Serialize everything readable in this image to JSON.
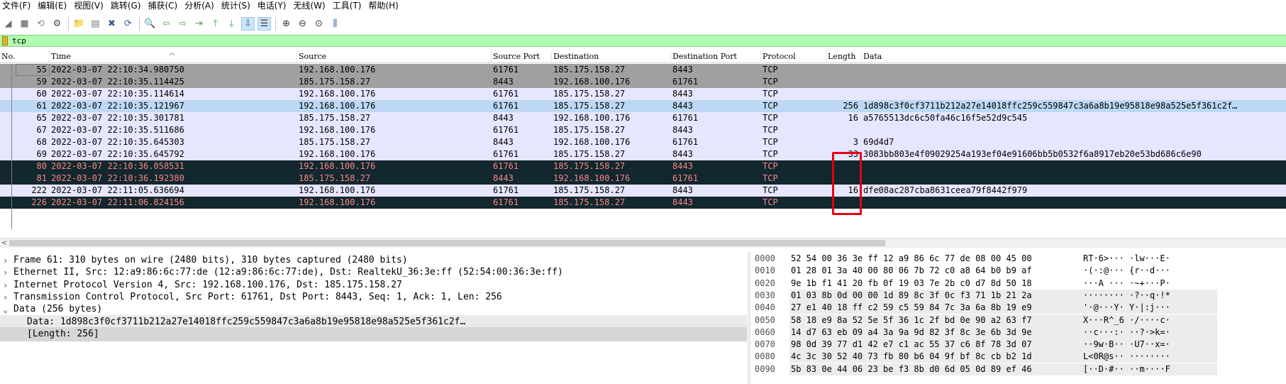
{
  "menu": [
    "文件(F)",
    "编辑(E)",
    "视图(V)",
    "跳转(G)",
    "捕获(C)",
    "分析(A)",
    "统计(S)",
    "电话(Y)",
    "无线(W)",
    "工具(T)",
    "帮助(H)"
  ],
  "toolbar": {
    "icons": [
      {
        "name": "shark-fin-start-icon",
        "glyph": "◢"
      },
      {
        "name": "stop-capture-icon",
        "glyph": "■"
      },
      {
        "name": "restart-capture-icon",
        "glyph": "⟲"
      },
      {
        "name": "capture-options-icon",
        "glyph": "⚙"
      },
      {
        "name": "open-file-icon",
        "glyph": "📁"
      },
      {
        "name": "save-file-icon",
        "glyph": "▤"
      },
      {
        "name": "close-file-icon",
        "glyph": "✖"
      },
      {
        "name": "reload-file-icon",
        "glyph": "⟳"
      },
      {
        "name": "find-packet-icon",
        "glyph": "🔍"
      },
      {
        "name": "go-back-icon",
        "glyph": "⇦"
      },
      {
        "name": "go-forward-icon",
        "glyph": "⇨"
      },
      {
        "name": "go-to-packet-icon",
        "glyph": "⇥"
      },
      {
        "name": "go-first-packet-icon",
        "glyph": "⤒"
      },
      {
        "name": "go-last-packet-icon",
        "glyph": "⤓"
      },
      {
        "name": "autoscroll-icon",
        "glyph": "⇩"
      },
      {
        "name": "colorize-icon",
        "glyph": "☰"
      },
      {
        "name": "zoom-in-icon",
        "glyph": "⊕"
      },
      {
        "name": "zoom-out-icon",
        "glyph": "⊖"
      },
      {
        "name": "zoom-normal-icon",
        "glyph": "⊙"
      },
      {
        "name": "resize-columns-icon",
        "glyph": "⫼"
      }
    ]
  },
  "filter": {
    "value": "tcp"
  },
  "columns": [
    "No.",
    "Time",
    "Source",
    "Source Port",
    "Destination",
    "Destination Port",
    "Protocol",
    "Length",
    "Data"
  ],
  "packets": [
    {
      "no": "55",
      "time": "2022-03-07 22:10:34.980750",
      "src": "192.168.100.176",
      "sport": "61761",
      "dst": "185.175.158.27",
      "dport": "8443",
      "proto": "TCP",
      "len": "",
      "data": "",
      "style": "gray"
    },
    {
      "no": "59",
      "time": "2022-03-07 22:10:35.114425",
      "src": "185.175.158.27",
      "sport": "8443",
      "dst": "192.168.100.176",
      "dport": "61761",
      "proto": "TCP",
      "len": "",
      "data": "",
      "style": "gray"
    },
    {
      "no": "60",
      "time": "2022-03-07 22:10:35.114614",
      "src": "192.168.100.176",
      "sport": "61761",
      "dst": "185.175.158.27",
      "dport": "8443",
      "proto": "TCP",
      "len": "",
      "data": "",
      "style": "lavender"
    },
    {
      "no": "61",
      "time": "2022-03-07 22:10:35.121967",
      "src": "192.168.100.176",
      "sport": "61761",
      "dst": "185.175.158.27",
      "dport": "8443",
      "proto": "TCP",
      "len": "256",
      "data": "1d898c3f0cf3711b212a27e14018ffc259c559847c3a6a8b19e95818e98a525e5f361c2f…",
      "style": "selected"
    },
    {
      "no": "65",
      "time": "2022-03-07 22:10:35.301781",
      "src": "185.175.158.27",
      "sport": "8443",
      "dst": "192.168.100.176",
      "dport": "61761",
      "proto": "TCP",
      "len": "16",
      "data": "a5765513dc6c50fa46c16f5e52d9c545",
      "style": "lavender"
    },
    {
      "no": "67",
      "time": "2022-03-07 22:10:35.511686",
      "src": "192.168.100.176",
      "sport": "61761",
      "dst": "185.175.158.27",
      "dport": "8443",
      "proto": "TCP",
      "len": "",
      "data": "",
      "style": "lavender"
    },
    {
      "no": "68",
      "time": "2022-03-07 22:10:35.645303",
      "src": "185.175.158.27",
      "sport": "8443",
      "dst": "192.168.100.176",
      "dport": "61761",
      "proto": "TCP",
      "len": "3",
      "data": "69d4d7",
      "style": "lavender"
    },
    {
      "no": "69",
      "time": "2022-03-07 22:10:35.645792",
      "src": "192.168.100.176",
      "sport": "61761",
      "dst": "185.175.158.27",
      "dport": "8443",
      "proto": "TCP",
      "len": "33",
      "data": "3083bb803e4f09029254a193ef04e91606bb5b0532f6a8917eb20e53bd686c6e90",
      "style": "lavender"
    },
    {
      "no": "80",
      "time": "2022-03-07 22:10:36.058531",
      "src": "192.168.100.176",
      "sport": "61761",
      "dst": "185.175.158.27",
      "dport": "8443",
      "proto": "TCP",
      "len": "",
      "data": "",
      "style": "dark"
    },
    {
      "no": "81",
      "time": "2022-03-07 22:10:36.192380",
      "src": "185.175.158.27",
      "sport": "8443",
      "dst": "192.168.100.176",
      "dport": "61761",
      "proto": "TCP",
      "len": "",
      "data": "",
      "style": "dark"
    },
    {
      "no": "222",
      "time": "2022-03-07 22:11:05.636694",
      "src": "192.168.100.176",
      "sport": "61761",
      "dst": "185.175.158.27",
      "dport": "8443",
      "proto": "TCP",
      "len": "16",
      "data": "dfe08ac287cba8631ceea79f8442f979",
      "style": "lavender"
    },
    {
      "no": "226",
      "time": "2022-03-07 22:11:06.824156",
      "src": "192.168.100.176",
      "sport": "61761",
      "dst": "185.175.158.27",
      "dport": "8443",
      "proto": "TCP",
      "len": "",
      "data": "",
      "style": "dark"
    }
  ],
  "details": [
    {
      "arrow": ">",
      "text": "Frame 61: 310 bytes on wire (2480 bits), 310 bytes captured (2480 bits)",
      "indent": 0,
      "bg": ""
    },
    {
      "arrow": ">",
      "text": "Ethernet II, Src: 12:a9:86:6c:77:de (12:a9:86:6c:77:de), Dst: RealtekU_36:3e:ff (52:54:00:36:3e:ff)",
      "indent": 0,
      "bg": ""
    },
    {
      "arrow": ">",
      "text": "Internet Protocol Version 4, Src: 192.168.100.176, Dst: 185.175.158.27",
      "indent": 0,
      "bg": ""
    },
    {
      "arrow": ">",
      "text": "Transmission Control Protocol, Src Port: 61761, Dst Port: 8443, Seq: 1, Ack: 1, Len: 256",
      "indent": 0,
      "bg": ""
    },
    {
      "arrow": "v",
      "text": "Data (256 bytes)",
      "indent": 0,
      "bg": ""
    },
    {
      "arrow": "",
      "text": "Data: 1d898c3f0cf3711b212a27e14018ffc259c559847c3a6a8b19e95818e98a525e5f361c2f…",
      "indent": 1,
      "bg": "sub"
    },
    {
      "arrow": "",
      "text": "[Length: 256]",
      "indent": 1,
      "bg": "sel"
    }
  ],
  "bytes": [
    {
      "off": "0000",
      "hex": "52 54 00 36 3e ff 12 a9   86 6c 77 de 08 00 45 00",
      "ascii": "RT·6>···  ·lw···E·",
      "hl": false
    },
    {
      "off": "0010",
      "hex": "01 28 01 3a 40 00 80 06   7b 72 c0 a8 64 b0 b9 af",
      "ascii": "·(·:@···  {r··d···",
      "hl": false
    },
    {
      "off": "0020",
      "hex": "9e 1b f1 41 20 fb 0f 19   03 7e 2b c0 d7 8d 50 18",
      "ascii": "···A ···  ·~+···P·",
      "hl": false
    },
    {
      "off": "0030",
      "hex": "01 03 8b 0d 00 00 1d 89   8c 3f 0c f3 71 1b 21 2a",
      "ascii": "········  ·?··q·!*",
      "hl": true
    },
    {
      "off": "0040",
      "hex": "27 e1 40 18 ff c2 59 c5   59 84 7c 3a 6a 8b 19 e9",
      "ascii": "'·@···Y·  Y·|:j···",
      "hl": true
    },
    {
      "off": "0050",
      "hex": "58 18 e9 8a 52 5e 5f 36   1c 2f bd 0e 90 a2 63 f7",
      "ascii": "X···R^_6  ·/····c·",
      "hl": true
    },
    {
      "off": "0060",
      "hex": "14 d7 63 eb 09 a4 3a 9a   9d 82 3f 8c 3e 6b 3d 9e",
      "ascii": "··c···:·  ··?·>k=·",
      "hl": true
    },
    {
      "off": "0070",
      "hex": "98 0d 39 77 d1 42 e7 c1   ac 55 37 c6 8f 78 3d 07",
      "ascii": "··9w·B··  ·U7··x=·",
      "hl": true
    },
    {
      "off": "0080",
      "hex": "4c 3c 30 52 40 73 fb 80   b6 04 9f bf 8c cb b2 1d",
      "ascii": "L<0R@s··  ········",
      "hl": true
    },
    {
      "off": "0090",
      "hex": "5b 83 0e 44 06 23 be f3   8b d0 6d 05 0d 89 ef 46",
      "ascii": "[··D·#··  ··m····F",
      "hl": true
    }
  ],
  "colors": {
    "gray": "#a0a0a0",
    "lavender": "#e7e6ff",
    "selected": "#bcd8f4",
    "dark": "#12272e",
    "dark_text": "#f78787",
    "filter_bg": "#afffaf",
    "highlight_box": "#e60012"
  }
}
